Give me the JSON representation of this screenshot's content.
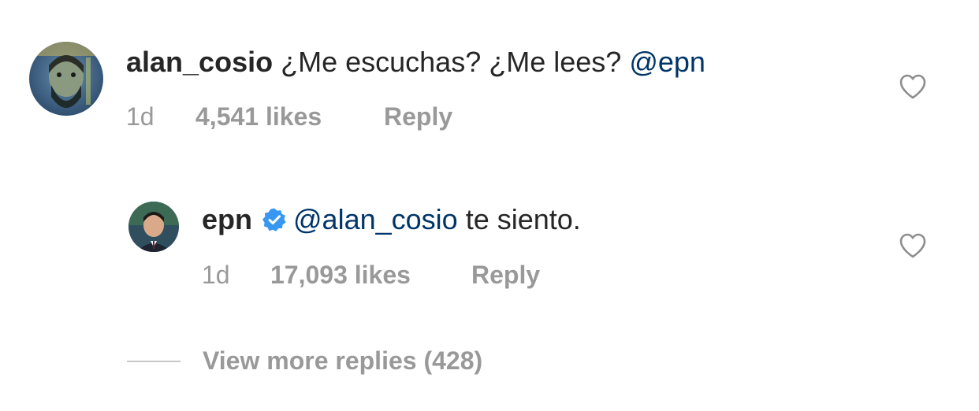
{
  "comment": {
    "username": "alan_cosio",
    "text": "¿Me escuchas? ¿Me lees?",
    "mention": "@epn",
    "time": "1d",
    "likes": "4,541 likes",
    "reply_label": "Reply",
    "avatar_icon": "user-avatar-icon",
    "like_icon": "heart-outline-icon"
  },
  "reply": {
    "username": "epn",
    "verified_icon": "verified-badge-icon",
    "mention": "@alan_cosio",
    "text": "te siento.",
    "time": "1d",
    "likes": "17,093 likes",
    "reply_label": "Reply",
    "avatar_icon": "user-avatar-icon",
    "like_icon": "heart-outline-icon"
  },
  "view_more": {
    "label": "View more replies (428)"
  },
  "colors": {
    "text": "#262626",
    "mention": "#003569",
    "secondary": "#999999",
    "verified": "#3897f0"
  }
}
